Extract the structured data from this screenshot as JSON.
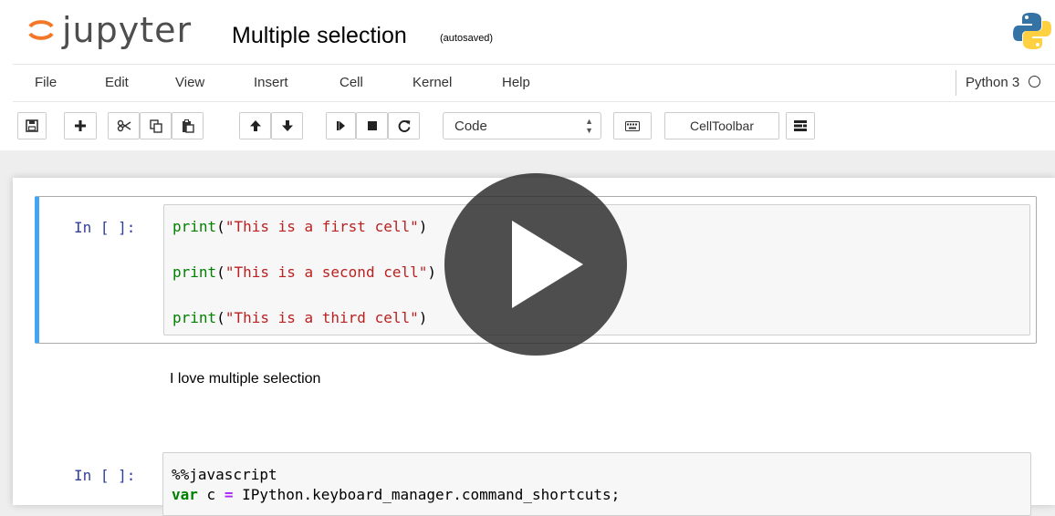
{
  "header": {
    "logo_text": "jupyter",
    "notebook_name": "Multiple selection",
    "autosave_status": "(autosaved)"
  },
  "menu": [
    "File",
    "Edit",
    "View",
    "Insert",
    "Cell",
    "Kernel",
    "Help"
  ],
  "kernel": {
    "name": "Python 3"
  },
  "toolbar": {
    "cell_type": "Code",
    "celltoolbar_label": "CellToolbar"
  },
  "cells": {
    "code1": {
      "prompt": "In [ ]:",
      "lines": [
        {
          "fn": "print",
          "open": "(",
          "str": "\"This is a first cell\"",
          "close": ")"
        },
        {
          "fn": "print",
          "open": "(",
          "str": "\"This is a second cell\"",
          "close": ")"
        },
        {
          "fn": "print",
          "open": "(",
          "str": "\"This is a third cell\"",
          "close": ")"
        }
      ]
    },
    "markdown": {
      "text": "I love multiple selection"
    },
    "code2": {
      "prompt": "In [ ]:",
      "magic": "%%javascript",
      "line2_kw": "var",
      "line2_var": " c ",
      "line2_op": "=",
      "line2_rest": " IPython.keyboard_manager.command_shortcuts;"
    }
  },
  "colors": {
    "selected_cell_border": "#42a5f5",
    "prompt": "#303f9f",
    "keyword": "#008000",
    "string": "#ba2121"
  },
  "icons": [
    "save-icon",
    "plus-icon",
    "scissors-icon",
    "copy-icon",
    "paste-icon",
    "arrow-up-icon",
    "arrow-down-icon",
    "step-forward-icon",
    "stop-icon",
    "restart-icon",
    "keyboard-icon",
    "layout-icon",
    "play-icon"
  ]
}
